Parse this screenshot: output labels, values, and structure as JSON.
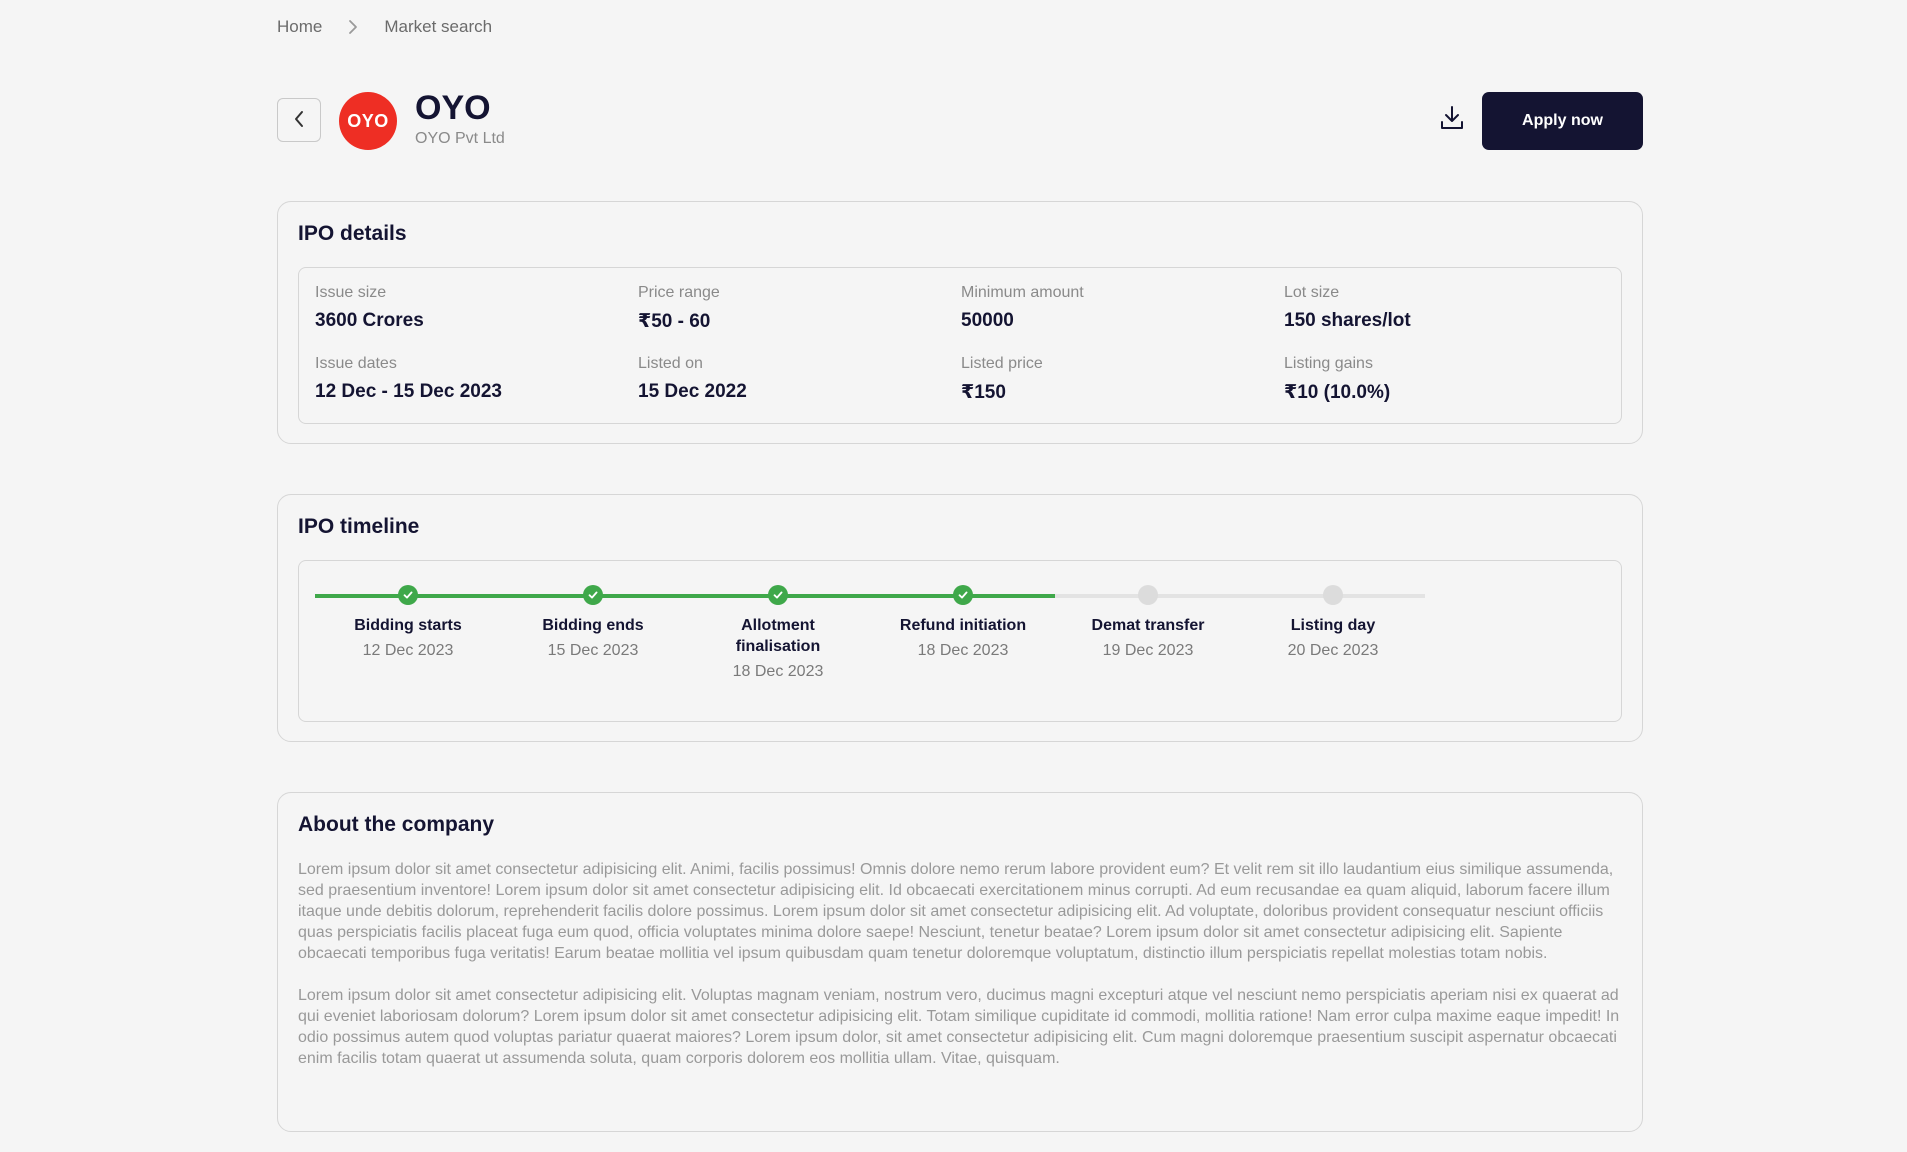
{
  "breadcrumb": {
    "home": "Home",
    "current": "Market search"
  },
  "header": {
    "logo_text": "OYO",
    "name": "OYO",
    "subtitle": "OYO Pvt Ltd",
    "apply_label": "Apply now"
  },
  "details": {
    "title": "IPO details",
    "items": [
      {
        "label": "Issue size",
        "value": "3600 Crores"
      },
      {
        "label": "Price range",
        "value": "₹50 - 60"
      },
      {
        "label": "Minimum amount",
        "value": "50000"
      },
      {
        "label": "Lot size",
        "value": "150 shares/lot"
      },
      {
        "label": "Issue dates",
        "value": "12 Dec - 15 Dec 2023"
      },
      {
        "label": "Listed on",
        "value": "15 Dec 2022"
      },
      {
        "label": "Listed price",
        "value": "₹150"
      },
      {
        "label": "Listing gains",
        "value": "₹10 (10.0%)"
      }
    ]
  },
  "timeline": {
    "title": "IPO timeline",
    "steps": [
      {
        "name": "Bidding starts",
        "date": "12 Dec 2023",
        "done": true
      },
      {
        "name": "Bidding ends",
        "date": "15 Dec 2023",
        "done": true
      },
      {
        "name": "Allotment finalisation",
        "date": "18 Dec 2023",
        "done": true
      },
      {
        "name": "Refund initiation",
        "date": "18 Dec 2023",
        "done": true
      },
      {
        "name": "Demat transfer",
        "date": "19 Dec 2023",
        "done": false
      },
      {
        "name": "Listing day",
        "date": "20 Dec 2023",
        "done": false
      }
    ]
  },
  "about": {
    "title": "About the company",
    "paragraphs": [
      "Lorem ipsum dolor sit amet consectetur adipisicing elit. Animi, facilis possimus! Omnis dolore nemo rerum labore provident eum? Et velit rem sit illo laudantium eius similique assumenda, sed praesentium inventore! Lorem ipsum dolor sit amet consectetur adipisicing elit. Id obcaecati exercitationem minus corrupti. Ad eum recusandae ea quam aliquid, laborum facere illum itaque unde debitis dolorum, reprehenderit facilis dolore possimus. Lorem ipsum dolor sit amet consectetur adipisicing elit. Ad voluptate, doloribus provident consequatur nesciunt officiis quas perspiciatis facilis placeat fuga eum quod, officia voluptates minima dolore saepe! Nesciunt, tenetur beatae? Lorem ipsum dolor sit amet consectetur adipisicing elit. Sapiente obcaecati temporibus fuga veritatis! Earum beatae mollitia vel ipsum quibusdam quam tenetur doloremque voluptatum, distinctio illum perspiciatis repellat molestias totam nobis.",
      "Lorem ipsum dolor sit amet consectetur adipisicing elit. Voluptas magnam veniam, nostrum vero, ducimus magni excepturi atque vel nesciunt nemo perspiciatis aperiam nisi ex quaerat ad qui eveniet laboriosam dolorum? Lorem ipsum dolor sit amet consectetur adipisicing elit. Totam similique cupiditate id commodi, mollitia ratione! Nam error culpa maxime eaque impedit! In odio possimus autem quod voluptas pariatur quaerat maiores? Lorem ipsum dolor, sit amet consectetur adipisicing elit. Cum magni doloremque praesentium suscipit aspernatur obcaecati enim facilis totam quaerat ut assumenda soluta, quam corporis dolorem eos mollitia ullam. Vitae, quisquam."
    ]
  },
  "colors": {
    "brand": "#ee2e24",
    "primary": "#141432",
    "success": "#3fa84a",
    "pending": "#dcdcdc"
  },
  "icons": {
    "back": "chevron-left-icon",
    "separator": "chevron-right-icon",
    "download": "download-icon",
    "check": "check-icon"
  }
}
